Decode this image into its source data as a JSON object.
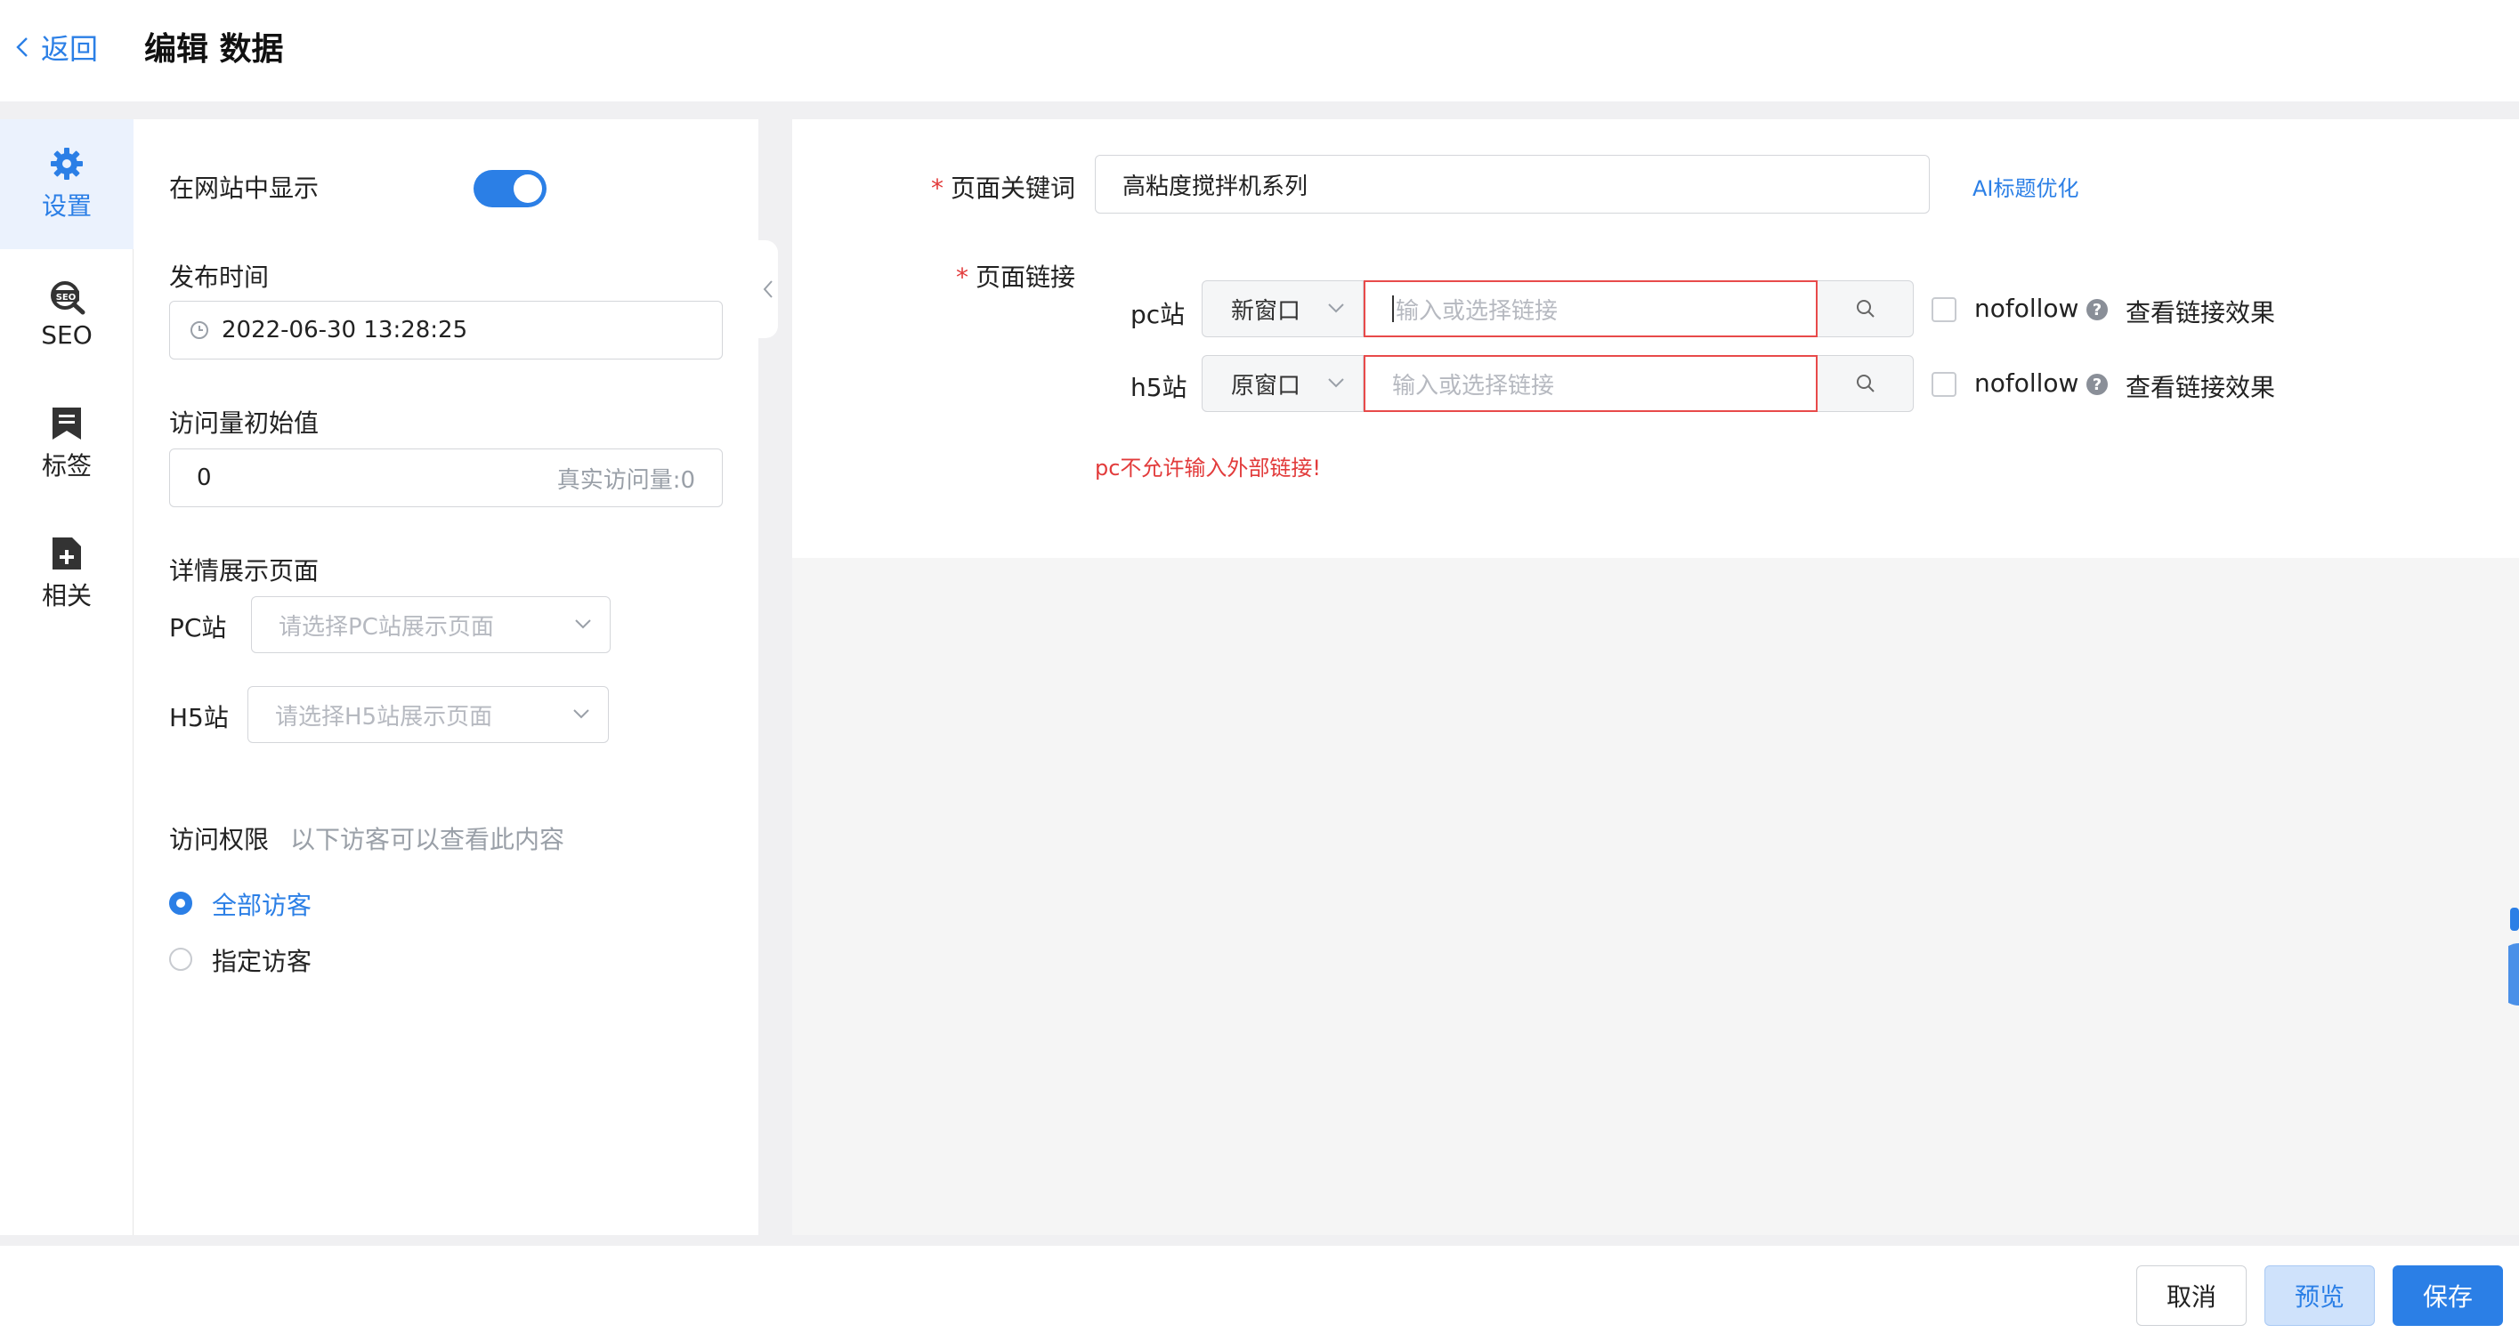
{
  "header": {
    "back_label": "返回",
    "title": "编辑 数据"
  },
  "nav": {
    "items": [
      {
        "label": "设置",
        "icon": "gear-icon"
      },
      {
        "label": "SEO",
        "icon": "seo-search-icon"
      },
      {
        "label": "标签",
        "icon": "tag-icon"
      },
      {
        "label": "相关",
        "icon": "related-doc-icon"
      }
    ],
    "active": "设置"
  },
  "settings": {
    "show_on_site_label": "在网站中显示",
    "show_on_site": true,
    "publish_time_label": "发布时间",
    "publish_time": "2022-06-30 13:28:25",
    "visits_label": "访问量初始值",
    "visits_value": "0",
    "real_visits": "真实访问量:0",
    "detail_page_label": "详情展示页面",
    "pc_label": "PC站",
    "pc_placeholder": "请选择PC站展示页面",
    "h5_label": "H5站",
    "h5_placeholder": "请选择H5站展示页面",
    "access_label": "访问权限",
    "access_hint": "以下访客可以查看此内容",
    "access_options": [
      "全部访客",
      "指定访客"
    ],
    "access_selected": "全部访客"
  },
  "main": {
    "keyword_label": "页面关键词",
    "keyword_value": "高粘度搅拌机系列",
    "ai_link": "AI标题优化",
    "page_link_label": "页面链接",
    "rows": [
      {
        "site": "pc站",
        "window": "新窗口",
        "placeholder": "输入或选择链接",
        "nofollow": "nofollow",
        "view": "查看链接效果"
      },
      {
        "site": "h5站",
        "window": "原窗口",
        "placeholder": "输入或选择链接",
        "nofollow": "nofollow",
        "view": "查看链接效果"
      }
    ],
    "error": "pc不允许输入外部链接!"
  },
  "footer": {
    "cancel": "取消",
    "preview": "预览",
    "save": "保存"
  },
  "colors": {
    "accent": "#2b7fe6",
    "error": "#e23b3b",
    "active_bg": "#ebf2fd"
  }
}
